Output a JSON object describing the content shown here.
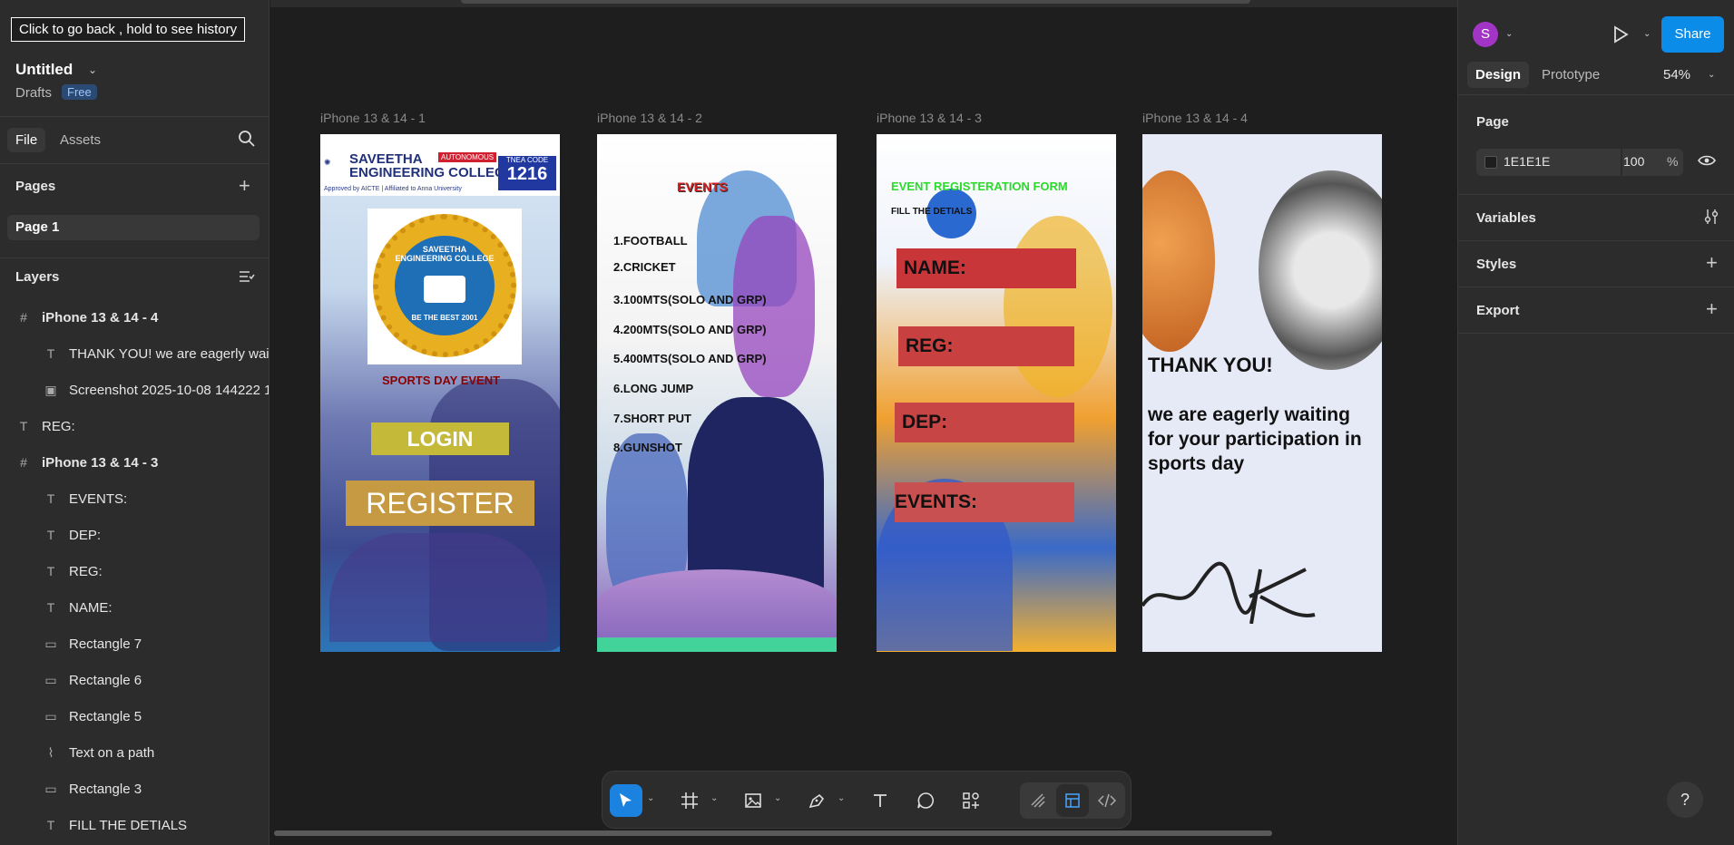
{
  "tooltip": "Click to go back , hold to see history",
  "file": {
    "title": "Untitled",
    "location": "Drafts",
    "plan_badge": "Free"
  },
  "left_tabs": {
    "file": "File",
    "assets": "Assets"
  },
  "pages": {
    "heading": "Pages",
    "items": [
      {
        "label": "Page 1"
      }
    ]
  },
  "layers": {
    "heading": "Layers",
    "items": [
      {
        "label": "iPhone 13 & 14 - 4",
        "type": "frame"
      },
      {
        "label": "THANK YOU! we are eagerly waiting for your participation in sports day",
        "type": "text"
      },
      {
        "label": "Screenshot 2025-10-08 144222 1",
        "type": "image"
      },
      {
        "label": "REG:",
        "type": "text"
      },
      {
        "label": "iPhone 13 & 14 - 3",
        "type": "frame"
      },
      {
        "label": "EVENTS:",
        "type": "text"
      },
      {
        "label": "DEP:",
        "type": "text"
      },
      {
        "label": "REG:",
        "type": "text"
      },
      {
        "label": "NAME:",
        "type": "text"
      },
      {
        "label": "Rectangle 7",
        "type": "rect"
      },
      {
        "label": "Rectangle 6",
        "type": "rect"
      },
      {
        "label": "Rectangle 5",
        "type": "rect"
      },
      {
        "label": "Text on a path",
        "type": "path"
      },
      {
        "label": "Rectangle 3",
        "type": "rect"
      },
      {
        "label": "FILL THE DETIALS",
        "type": "text"
      }
    ]
  },
  "canvas": {
    "background": "#1E1E1E",
    "frames": [
      {
        "label": "iPhone 13 & 14 - 1",
        "header_college": "SAVEETHA\nENGINEERING COLLEGE",
        "header_autonomous": "AUTONOMOUS",
        "header_tnea_label": "TNEA CODE",
        "header_tnea_code": "1216",
        "header_affiliation": "Approved by AICTE | Affiliated to Anna University",
        "emblem_top": "SAVEETHA ENGINEERING COLLEGE",
        "emblem_motto": "BE THE BEST 2001",
        "event_title": "SPORTS DAY EVENT",
        "login_label": "LOGIN",
        "register_label": "REGISTER"
      },
      {
        "label": "iPhone 13 & 14 - 2",
        "title": "EVENTS",
        "events": [
          "1.FOOTBALL",
          "2.CRICKET",
          "3.100MTS(SOLO AND GRP)",
          "4.200MTS(SOLO AND GRP)",
          "5.400MTS(SOLO AND GRP)",
          "6.LONG JUMP",
          "7.SHORT PUT",
          "8.GUNSHOT"
        ]
      },
      {
        "label": "iPhone 13 & 14 - 3",
        "title": "EVENT REGISTERATION FORM",
        "subtitle": "FILL THE DETIALS",
        "fields": [
          "NAME:",
          "REG:",
          "DEP:",
          "EVENTS:"
        ]
      },
      {
        "label": "iPhone 13 & 14 - 4",
        "thanks": "THANK YOU!",
        "message": "we are eagerly waiting for your participation in sports day"
      }
    ]
  },
  "toolbar": {
    "tools": [
      "move-tool",
      "frame-tool",
      "image-tool",
      "pen-tool",
      "text-tool",
      "comment-tool",
      "actions-tool"
    ],
    "modes": [
      "draw-mode",
      "design-mode",
      "dev-mode"
    ]
  },
  "right_panel": {
    "avatar_initial": "S",
    "share_label": "Share",
    "tabs": {
      "design": "Design",
      "prototype": "Prototype"
    },
    "zoom": "54%",
    "page_section": {
      "heading": "Page",
      "fill_hex": "1E1E1E",
      "opacity": "100",
      "opacity_unit": "%"
    },
    "sections": [
      "Variables",
      "Styles",
      "Export"
    ],
    "help_label": "?"
  },
  "colors": {
    "accent": "#0C8CE9",
    "avatar": "#A335C6",
    "panel": "#2C2C2C",
    "canvas": "#1E1E1E"
  }
}
